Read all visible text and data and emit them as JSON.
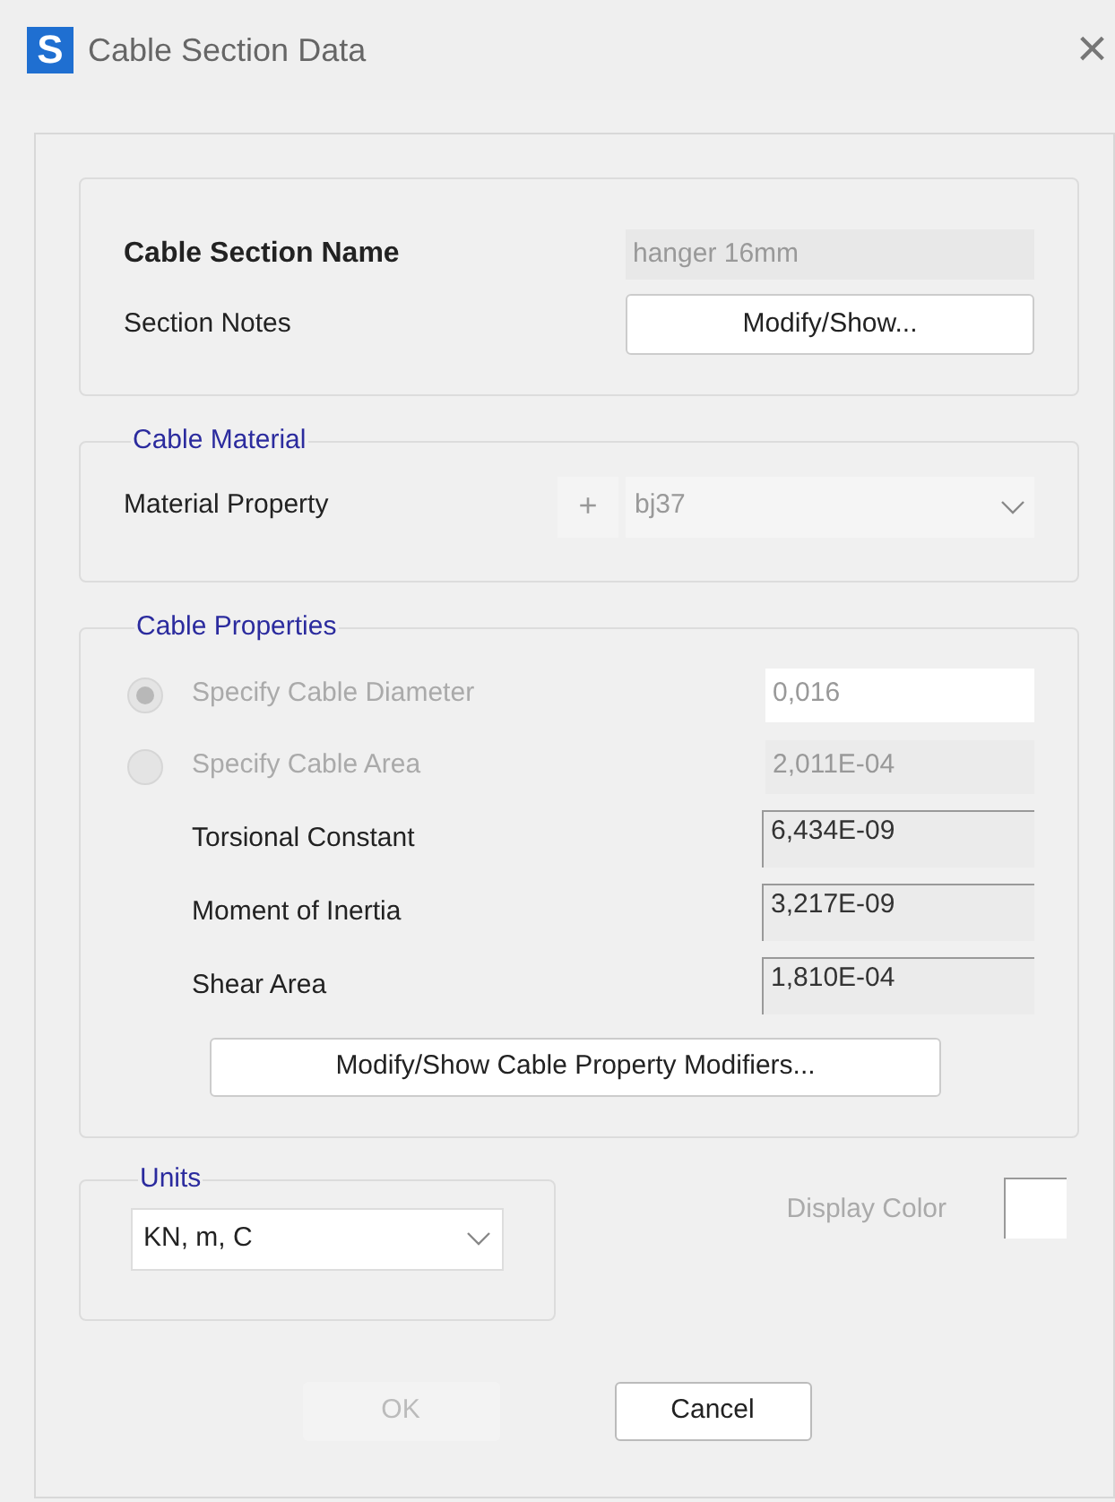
{
  "window": {
    "logo": "S",
    "title": "Cable Section Data",
    "close": "×"
  },
  "section": {
    "name_label": "Cable Section Name",
    "name_value": "hanger 16mm",
    "notes_label": "Section Notes",
    "notes_button": "Modify/Show..."
  },
  "material": {
    "title": "Cable Material",
    "label": "Material Property",
    "add_button": "+",
    "value": "bj37"
  },
  "properties": {
    "title": "Cable Properties",
    "options": [
      {
        "label": "Specify Cable Diameter",
        "value": "0,016",
        "selected": true,
        "disabled": true
      },
      {
        "label": "Specify Cable Area",
        "value": "2,011E-04",
        "selected": false,
        "disabled": true
      }
    ],
    "fields": [
      {
        "label": "Torsional Constant",
        "value": "6,434E-09"
      },
      {
        "label": "Moment of Inertia",
        "value": "3,217E-09"
      },
      {
        "label": "Shear Area",
        "value": "1,810E-04"
      }
    ],
    "modifiers_button": "Modify/Show Cable Property Modifiers..."
  },
  "units": {
    "title": "Units",
    "value": "KN, m, C"
  },
  "display_color": {
    "label": "Display Color",
    "color": "#ffffff"
  },
  "buttons": [
    {
      "label": "OK",
      "disabled": true
    },
    {
      "label": "Cancel",
      "disabled": false
    }
  ]
}
